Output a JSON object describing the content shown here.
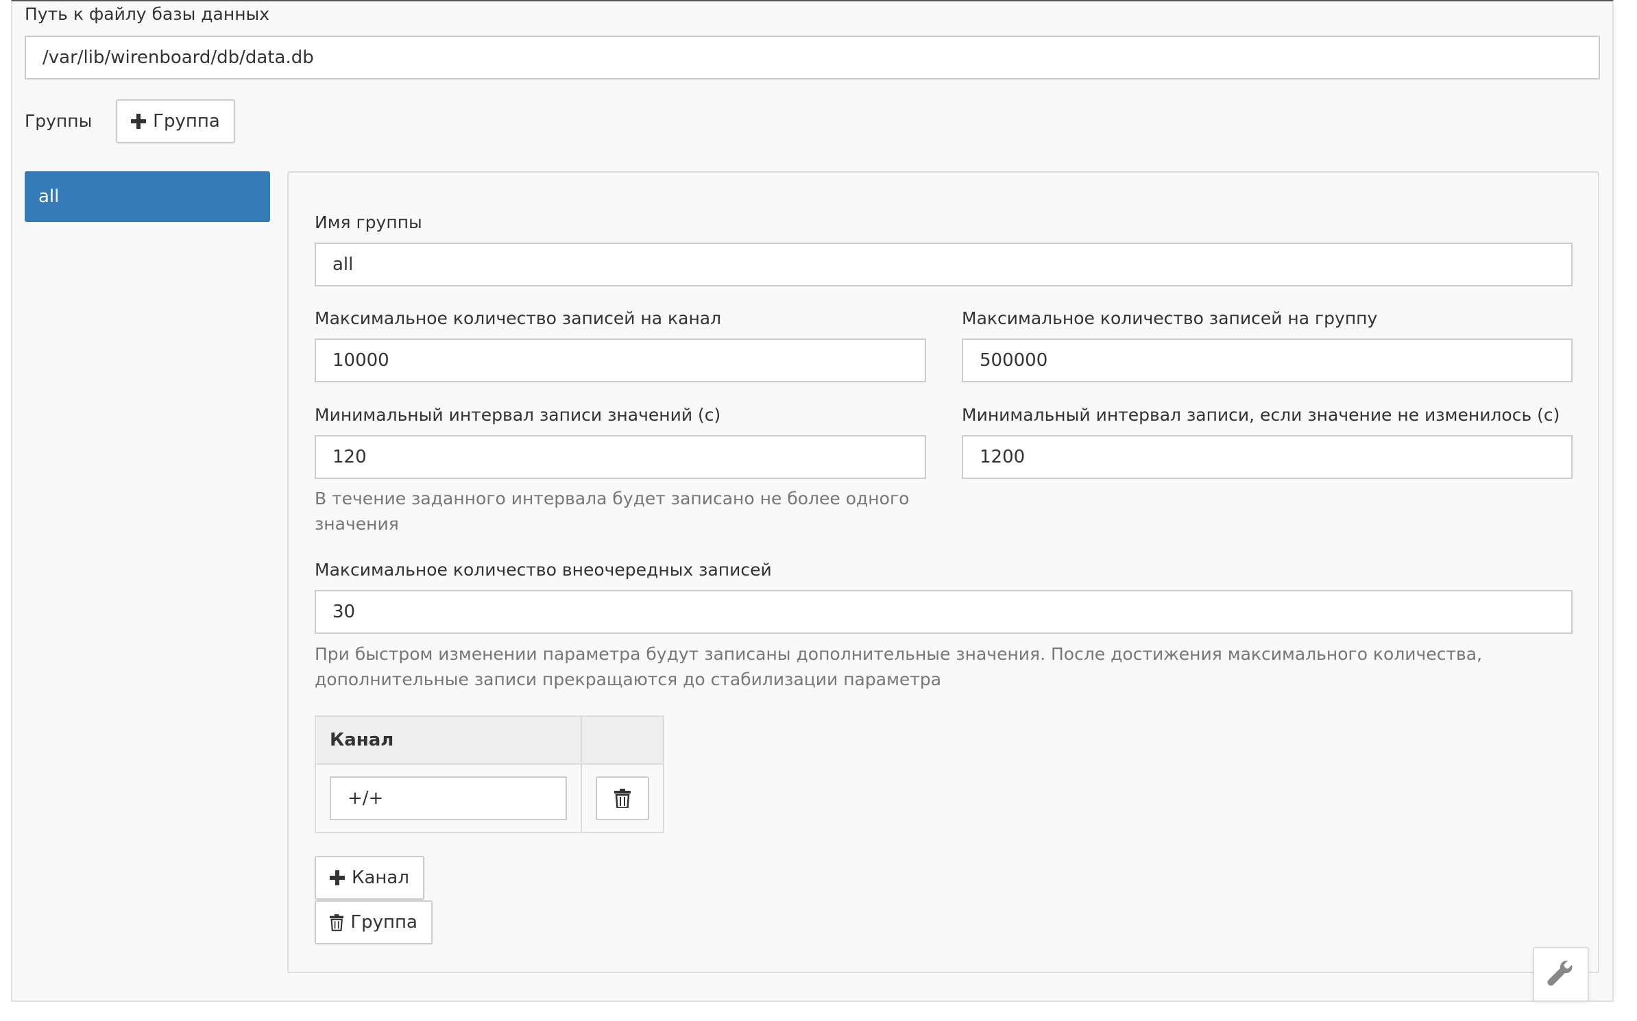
{
  "db": {
    "label": "Путь к файлу базы данных",
    "value": "/var/lib/wirenboard/db/data.db"
  },
  "groups": {
    "label": "Группы",
    "add_button": "Группа",
    "items": [
      {
        "label": "all",
        "selected": true
      }
    ]
  },
  "group": {
    "name_label": "Имя группы",
    "name_value": "all",
    "max_per_channel_label": "Максимальное количество записей на канал",
    "max_per_channel_value": "10000",
    "max_per_group_label": "Максимальное количество записей на группу",
    "max_per_group_value": "500000",
    "min_interval_label": "Минимальный интервал записи значений (с)",
    "min_interval_value": "120",
    "min_interval_help": "В течение заданного интервала будет записано не более одного значения",
    "min_interval_unchanged_label": "Минимальный интервал записи, если значение не изменилось (с)",
    "min_interval_unchanged_value": "1200",
    "max_unordered_label": "Максимальное количество внеочередных записей",
    "max_unordered_value": "30",
    "max_unordered_help": "При быстром изменении параметра будут записаны дополнительные значения. После достижения максимального количества, дополнительные записи прекращаются до стабилизации параметра",
    "channels_header": "Канал",
    "channels": [
      {
        "value": "+/+"
      }
    ],
    "add_channel_button": "Канал",
    "delete_group_button": "Группа"
  },
  "colors": {
    "accent": "#337ab7",
    "panel_bg": "#f9f9f9",
    "border": "#cccccc",
    "help_text": "#777777"
  },
  "icons": {
    "add": "plus-icon",
    "delete": "trash-icon",
    "settings": "wrench-icon"
  }
}
